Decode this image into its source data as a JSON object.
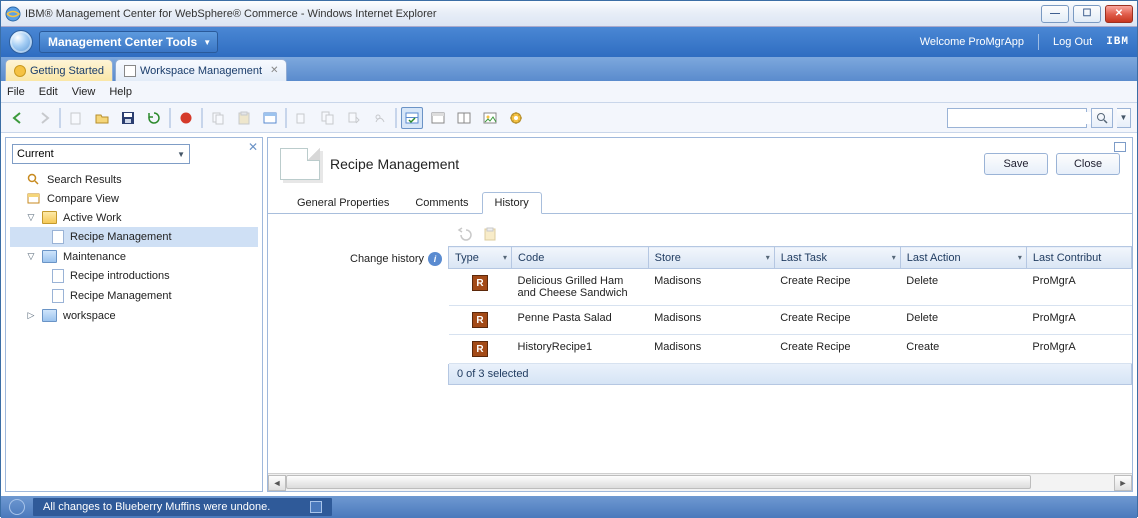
{
  "window": {
    "title": "IBM® Management Center for WebSphere® Commerce - Windows Internet Explorer"
  },
  "mgmt": {
    "tools_label": "Management Center Tools",
    "welcome": "Welcome ProMgrApp",
    "logout": "Log Out",
    "ibm": "IBM"
  },
  "apptabs": {
    "getting": "Getting Started",
    "workspace": "Workspace Management"
  },
  "menu": {
    "file": "File",
    "edit": "Edit",
    "view": "View",
    "help": "Help"
  },
  "nav": {
    "selector": "Current",
    "items": {
      "search": "Search Results",
      "compare": "Compare View",
      "active": "Active Work",
      "recipe_mgmt": "Recipe Management",
      "maintenance": "Maintenance",
      "recipe_intro": "Recipe introductions",
      "recipe_mgmt2": "Recipe Management",
      "workspace": "workspace"
    }
  },
  "editor": {
    "title": "Recipe Management",
    "save": "Save",
    "close": "Close",
    "tabs": {
      "general": "General Properties",
      "comments": "Comments",
      "history": "History"
    },
    "history_label": "Change history",
    "columns": {
      "type": "Type",
      "code": "Code",
      "store": "Store",
      "last_task": "Last Task",
      "last_action": "Last Action",
      "last_contrib": "Last Contribut"
    },
    "rows": [
      {
        "code": "Delicious Grilled Ham and Cheese Sandwich",
        "store": "Madisons",
        "task": "Create Recipe",
        "action": "Delete",
        "contrib": "ProMgrA"
      },
      {
        "code": "Penne Pasta Salad",
        "store": "Madisons",
        "task": "Create Recipe",
        "action": "Delete",
        "contrib": "ProMgrA"
      },
      {
        "code": "HistoryRecipe1",
        "store": "Madisons",
        "task": "Create Recipe",
        "action": "Create",
        "contrib": "ProMgrA"
      }
    ],
    "status": "0 of 3 selected"
  },
  "statusbar": {
    "message": "All changes to Blueberry Muffins were undone."
  }
}
